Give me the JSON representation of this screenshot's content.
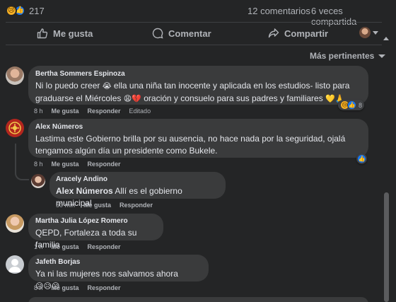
{
  "post_stats": {
    "reaction_icons": [
      "sad-icon",
      "like-icon"
    ],
    "reactions_count": "217",
    "comments": "12 comentarios",
    "shares": "6 veces compartida"
  },
  "actions": {
    "like": "Me gusta",
    "comment": "Comentar",
    "share": "Compartir"
  },
  "sort_label": "Más pertinentes",
  "colors": {
    "background": "#242526",
    "bubble": "#3a3b3c",
    "text": "#e4e6eb",
    "muted": "#b0b3b8",
    "like_blue": "#1877f2",
    "sad_yellow": "#f7b125"
  },
  "comments": [
    {
      "author": "Bertha Sommers Espinoza",
      "text_part1": "Ni lo puedo creer ",
      "emoji1": "😭",
      "text_part2": " ella una niña tan inocente y aplicada en los estudios- listo para graduarse el Miércoles ",
      "emoji2": "😩💔",
      "text_part3": " oración y consuelo para sus padres y familiares ",
      "emoji3": "💛🙏",
      "time": "8 h",
      "like": "Me gusta",
      "reply": "Responder",
      "edited": "Editado",
      "reactions_count": "8"
    },
    {
      "author": "Alex Números",
      "text": "Lastima este Gobierno brilla por su ausencia, no hace nada por la seguridad, ojalá tengamos algún día un presidente como Bukele.",
      "time": "8 h",
      "like": "Me gusta",
      "reply": "Responder"
    },
    {
      "author": "Aracely Andino",
      "mention": "Alex Números",
      "text": " Allí es el gobierno municipal",
      "time": "50 min",
      "like": "Me gusta",
      "reply": "Responder"
    },
    {
      "author": "Martha Julia López Romero",
      "text": "QEPD, Fortaleza a toda su familia",
      "time": "1 h",
      "like": "Me gusta",
      "reply": "Responder"
    },
    {
      "author": "Jafeth Borjas",
      "text": "Ya ni las mujeres nos salvamos ahora",
      "emoji": "😥😥😥",
      "time": "8 h",
      "like": "Me gusta",
      "reply": "Responder"
    }
  ]
}
